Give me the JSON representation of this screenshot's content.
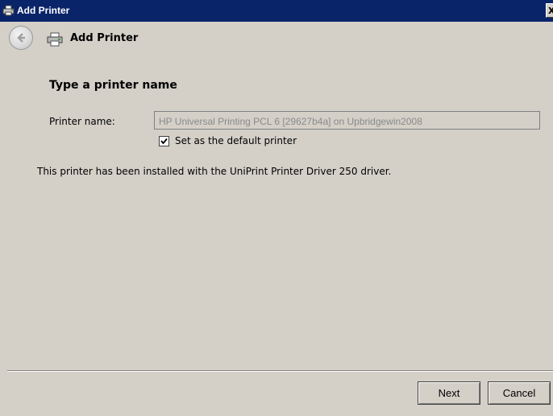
{
  "window": {
    "title": "Add Printer",
    "close_glyph": "X"
  },
  "nav": {
    "title": "Add Printer",
    "back_icon": "back-arrow-icon",
    "printer_icon": "printer-icon"
  },
  "page": {
    "heading": "Type a printer name",
    "printer_name_label": "Printer name:",
    "printer_name_value": "HP Universal Printing PCL 6 [29627b4a] on Upbridgewin2008",
    "default_checkbox_label": "Set as the default printer",
    "default_checked": true,
    "info_text": "This printer has been installed with the UniPrint Printer Driver 250 driver."
  },
  "buttons": {
    "next": "Next",
    "cancel": "Cancel"
  },
  "colors": {
    "titlebar": "#0a246a",
    "window_bg": "#d4d0c8"
  }
}
